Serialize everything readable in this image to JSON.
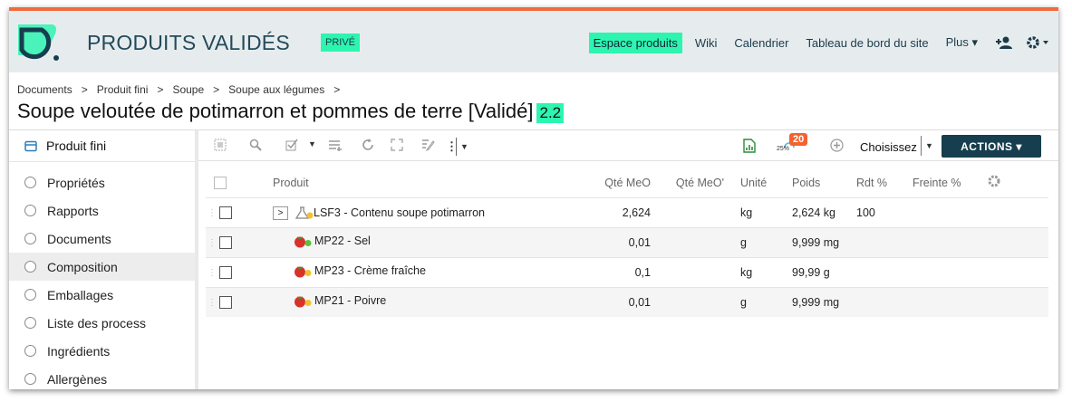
{
  "header": {
    "site_title": "PRODUITS VALIDÉS",
    "badge": "PRIVÉ",
    "nav": [
      "Espace produits",
      "Wiki",
      "Calendrier",
      "Tableau de bord du site",
      "Plus ▾"
    ],
    "accent": "#2df5b0",
    "brand": "#163e4e"
  },
  "breadcrumb": [
    "Documents",
    "Produit fini",
    "Soupe",
    "Soupe aux légumes"
  ],
  "breadcrumb_sep": ">",
  "doc": {
    "title": "Soupe veloutée de potimarron et pommes de terre [Validé]",
    "version": "2.2"
  },
  "sidebar": {
    "header": "Produit fini",
    "items": [
      "Propriétés",
      "Rapports",
      "Documents",
      "Composition",
      "Emballages",
      "Liste des process",
      "Ingrédients",
      "Allergènes"
    ],
    "active": "Composition"
  },
  "toolbar": {
    "count": "20",
    "percent": "25%",
    "select_value": "Choisissez",
    "actions_label": "ACTIONS ▾"
  },
  "table": {
    "columns": [
      "Produit",
      "Qté MeO",
      "Qté MeO'",
      "Unité",
      "Poids",
      "Rdt %",
      "Freinte %"
    ],
    "rows": [
      {
        "produit": "LSF3 - Contenu soupe potimarron",
        "qte": "2,624",
        "qte2": "",
        "unite": "kg",
        "poids": "2,624 kg",
        "rdt": "100",
        "freinte": ""
      },
      {
        "produit": "MP22 - Sel",
        "qte": "0,01",
        "qte2": "",
        "unite": "g",
        "poids": "9,999 mg",
        "rdt": "",
        "freinte": ""
      },
      {
        "produit": "MP23 - Crème fraîche",
        "qte": "0,1",
        "qte2": "",
        "unite": "kg",
        "poids": "99,99 g",
        "rdt": "",
        "freinte": ""
      },
      {
        "produit": "MP21 - Poivre",
        "qte": "0,01",
        "qte2": "",
        "unite": "g",
        "poids": "9,999 mg",
        "rdt": "",
        "freinte": ""
      }
    ]
  }
}
